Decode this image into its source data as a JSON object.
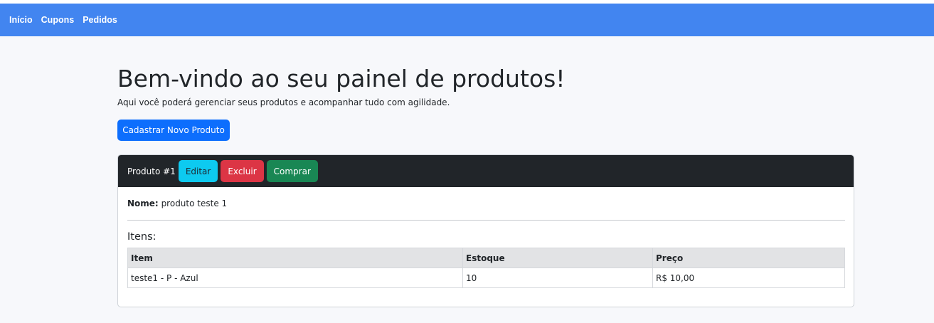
{
  "nav": {
    "links": [
      "Início",
      "Cupons",
      "Pedidos"
    ],
    "background": "#4285f0"
  },
  "page": {
    "title": "Bem-vindo ao seu painel de produtos!",
    "subtitle": "Aqui você poderá gerenciar seus produtos e acompanhar tudo com agilidade.",
    "new_product_button": "Cadastrar Novo Produto"
  },
  "product": {
    "header_title": "Produto #1",
    "edit_label": "Editar",
    "delete_label": "Excluir",
    "buy_label": "Comprar",
    "name_label": "Nome:",
    "name_value": "produto teste 1",
    "items_heading": "Itens:",
    "table": {
      "headers": [
        "Item",
        "Estoque",
        "Preço"
      ],
      "rows": [
        [
          "teste1 - P - Azul",
          "10",
          "R$ 10,00"
        ]
      ]
    }
  },
  "colors": {
    "primary": "#0d6efd",
    "info": "#0dcaf0",
    "danger": "#dc3545",
    "success": "#198754",
    "dark": "#212529"
  }
}
